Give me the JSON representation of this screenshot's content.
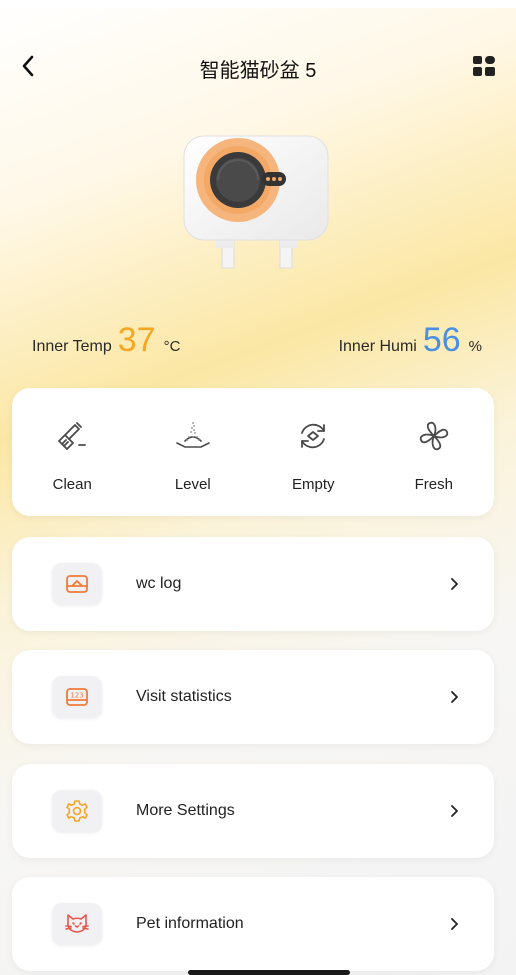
{
  "header": {
    "title": "智能猫砂盆 5"
  },
  "device_image": {
    "icon": "cat-litter-box-icon"
  },
  "readings": {
    "temp": {
      "label": "Inner Temp",
      "value": "37",
      "unit": "°C"
    },
    "humi": {
      "label": "Inner Humi",
      "value": "56",
      "unit": "%"
    }
  },
  "actions": [
    {
      "label": "Clean",
      "icon": "broom-icon"
    },
    {
      "label": "Level",
      "icon": "sand-level-icon"
    },
    {
      "label": "Empty",
      "icon": "empty-cycle-icon"
    },
    {
      "label": "Fresh",
      "icon": "fan-icon"
    }
  ],
  "menu": [
    {
      "label": "wc log",
      "icon": "litter-tray-icon"
    },
    {
      "label": "Visit statistics",
      "icon": "counter-123-icon"
    },
    {
      "label": "More Settings",
      "icon": "gear-icon"
    },
    {
      "label": "Pet information",
      "icon": "cat-face-icon"
    }
  ],
  "colors": {
    "accent": "#f07a3a",
    "temp": "#f5a623",
    "humi": "#4a90e2"
  }
}
